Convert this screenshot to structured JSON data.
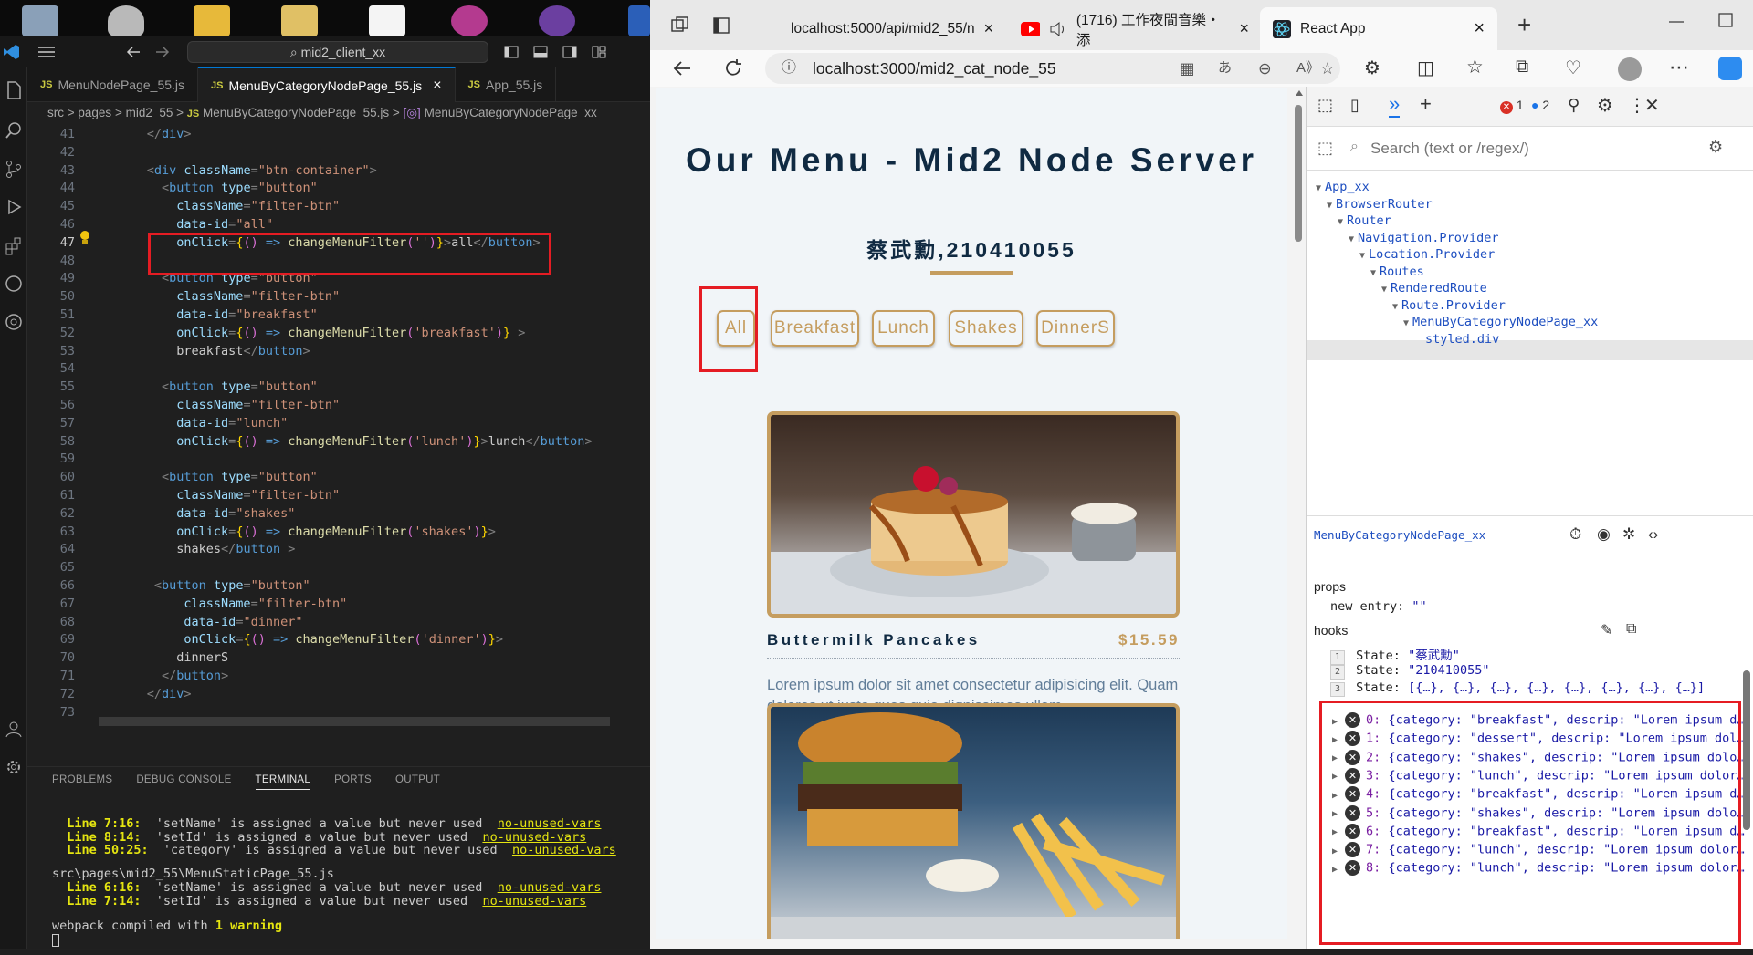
{
  "vscode": {
    "search": "mid2_client_xx",
    "tabs": [
      {
        "label": "MenuNodePage_55.js",
        "active": false
      },
      {
        "label": "MenuByCategoryNodePage_55.js",
        "active": true
      },
      {
        "label": "App_55.js",
        "active": false
      }
    ],
    "tab_close": "×",
    "breadcrumb": [
      "src",
      "pages",
      "mid2_55",
      "MenuByCategoryNodePage_55.js",
      "MenuByCategoryNodePage_xx"
    ],
    "code_lines": [
      {
        "n": "41",
        "parts": [
          [
            "g",
            "      </"
          ],
          [
            "t",
            "div"
          ],
          [
            "g",
            ">"
          ]
        ]
      },
      {
        "n": "42",
        "parts": []
      },
      {
        "n": "43",
        "parts": [
          [
            "g",
            "      <"
          ],
          [
            "t",
            "div"
          ],
          [
            "a",
            " className"
          ],
          [
            "g",
            "="
          ],
          [
            "s",
            "\"btn-container\""
          ],
          [
            "g",
            ">"
          ]
        ]
      },
      {
        "n": "44",
        "parts": [
          [
            "g",
            "        <"
          ],
          [
            "t",
            "button"
          ],
          [
            "a",
            " type"
          ],
          [
            "g",
            "="
          ],
          [
            "s",
            "\"button\""
          ]
        ]
      },
      {
        "n": "45",
        "parts": [
          [
            "a",
            "          className"
          ],
          [
            "g",
            "="
          ],
          [
            "s",
            "\"filter-btn\""
          ]
        ]
      },
      {
        "n": "46",
        "parts": [
          [
            "a",
            "          data-id"
          ],
          [
            "g",
            "="
          ],
          [
            "s",
            "\"all\""
          ]
        ]
      },
      {
        "n": "47",
        "parts": [
          [
            "a",
            "          onClick"
          ],
          [
            "g",
            "="
          ],
          [
            "b",
            "{"
          ],
          [
            "p",
            "()"
          ],
          [
            "t",
            " =>"
          ],
          [
            "f",
            " changeMenuFilter"
          ],
          [
            "p",
            "("
          ],
          [
            "s",
            "''"
          ],
          [
            "p",
            ")"
          ],
          [
            "b",
            "}"
          ],
          [
            "g",
            ">"
          ],
          [
            "x",
            "all"
          ],
          [
            "g",
            "</"
          ],
          [
            "t",
            "button"
          ],
          [
            "g",
            ">"
          ]
        ]
      },
      {
        "n": "48",
        "parts": []
      },
      {
        "n": "49",
        "parts": [
          [
            "g",
            "        <"
          ],
          [
            "t",
            "button"
          ],
          [
            "a",
            " type"
          ],
          [
            "g",
            "="
          ],
          [
            "s",
            "\"button\""
          ]
        ]
      },
      {
        "n": "50",
        "parts": [
          [
            "a",
            "          className"
          ],
          [
            "g",
            "="
          ],
          [
            "s",
            "\"filter-btn\""
          ]
        ]
      },
      {
        "n": "51",
        "parts": [
          [
            "a",
            "          data-id"
          ],
          [
            "g",
            "="
          ],
          [
            "s",
            "\"breakfast\""
          ]
        ]
      },
      {
        "n": "52",
        "parts": [
          [
            "a",
            "          onClick"
          ],
          [
            "g",
            "="
          ],
          [
            "b",
            "{"
          ],
          [
            "p",
            "()"
          ],
          [
            "t",
            " =>"
          ],
          [
            "f",
            " changeMenuFilter"
          ],
          [
            "p",
            "("
          ],
          [
            "s",
            "'breakfast'"
          ],
          [
            "p",
            ")"
          ],
          [
            "b",
            "}"
          ],
          [
            "g",
            " >"
          ]
        ]
      },
      {
        "n": "53",
        "parts": [
          [
            "x",
            "          breakfast"
          ],
          [
            "g",
            "</"
          ],
          [
            "t",
            "button"
          ],
          [
            "g",
            ">"
          ]
        ]
      },
      {
        "n": "54",
        "parts": []
      },
      {
        "n": "55",
        "parts": [
          [
            "g",
            "        <"
          ],
          [
            "t",
            "button"
          ],
          [
            "a",
            " type"
          ],
          [
            "g",
            "="
          ],
          [
            "s",
            "\"button\""
          ]
        ]
      },
      {
        "n": "56",
        "parts": [
          [
            "a",
            "          className"
          ],
          [
            "g",
            "="
          ],
          [
            "s",
            "\"filter-btn\""
          ]
        ]
      },
      {
        "n": "57",
        "parts": [
          [
            "a",
            "          data-id"
          ],
          [
            "g",
            "="
          ],
          [
            "s",
            "\"lunch\""
          ]
        ]
      },
      {
        "n": "58",
        "parts": [
          [
            "a",
            "          onClick"
          ],
          [
            "g",
            "="
          ],
          [
            "b",
            "{"
          ],
          [
            "p",
            "()"
          ],
          [
            "t",
            " =>"
          ],
          [
            "f",
            " changeMenuFilter"
          ],
          [
            "p",
            "("
          ],
          [
            "s",
            "'lunch'"
          ],
          [
            "p",
            ")"
          ],
          [
            "b",
            "}"
          ],
          [
            "g",
            ">"
          ],
          [
            "x",
            "lunch"
          ],
          [
            "g",
            "</"
          ],
          [
            "t",
            "button"
          ],
          [
            "g",
            ">"
          ]
        ]
      },
      {
        "n": "59",
        "parts": []
      },
      {
        "n": "60",
        "parts": [
          [
            "g",
            "        <"
          ],
          [
            "t",
            "button"
          ],
          [
            "a",
            " type"
          ],
          [
            "g",
            "="
          ],
          [
            "s",
            "\"button\""
          ]
        ]
      },
      {
        "n": "61",
        "parts": [
          [
            "a",
            "          className"
          ],
          [
            "g",
            "="
          ],
          [
            "s",
            "\"filter-btn\""
          ]
        ]
      },
      {
        "n": "62",
        "parts": [
          [
            "a",
            "          data-id"
          ],
          [
            "g",
            "="
          ],
          [
            "s",
            "\"shakes\""
          ]
        ]
      },
      {
        "n": "63",
        "parts": [
          [
            "a",
            "          onClick"
          ],
          [
            "g",
            "="
          ],
          [
            "b",
            "{"
          ],
          [
            "p",
            "()"
          ],
          [
            "t",
            " =>"
          ],
          [
            "f",
            " changeMenuFilter"
          ],
          [
            "p",
            "("
          ],
          [
            "s",
            "'shakes'"
          ],
          [
            "p",
            ")"
          ],
          [
            "b",
            "}"
          ],
          [
            "g",
            ">"
          ]
        ]
      },
      {
        "n": "64",
        "parts": [
          [
            "x",
            "          shakes"
          ],
          [
            "g",
            "</"
          ],
          [
            "t",
            "button"
          ],
          [
            "g",
            " >"
          ]
        ]
      },
      {
        "n": "65",
        "parts": []
      },
      {
        "n": "66",
        "parts": [
          [
            "g",
            "       <"
          ],
          [
            "t",
            "button"
          ],
          [
            "a",
            " type"
          ],
          [
            "g",
            "="
          ],
          [
            "s",
            "\"button\""
          ]
        ]
      },
      {
        "n": "67",
        "parts": [
          [
            "a",
            "           className"
          ],
          [
            "g",
            "="
          ],
          [
            "s",
            "\"filter-btn\""
          ]
        ]
      },
      {
        "n": "68",
        "parts": [
          [
            "a",
            "           data-id"
          ],
          [
            "g",
            "="
          ],
          [
            "s",
            "\"dinner\""
          ]
        ]
      },
      {
        "n": "69",
        "parts": [
          [
            "a",
            "           onClick"
          ],
          [
            "g",
            "="
          ],
          [
            "b",
            "{"
          ],
          [
            "p",
            "()"
          ],
          [
            "t",
            " =>"
          ],
          [
            "f",
            " changeMenuFilter"
          ],
          [
            "p",
            "("
          ],
          [
            "s",
            "'dinner'"
          ],
          [
            "p",
            ")"
          ],
          [
            "b",
            "}"
          ],
          [
            "g",
            ">"
          ]
        ]
      },
      {
        "n": "70",
        "parts": [
          [
            "x",
            "          dinnerS"
          ]
        ]
      },
      {
        "n": "71",
        "parts": [
          [
            "g",
            "        </"
          ],
          [
            "t",
            "button"
          ],
          [
            "g",
            ">"
          ]
        ]
      },
      {
        "n": "72",
        "parts": [
          [
            "g",
            "      </"
          ],
          [
            "t",
            "div"
          ],
          [
            "g",
            ">"
          ]
        ]
      },
      {
        "n": "73",
        "parts": []
      }
    ],
    "panel_tabs": [
      "PROBLEMS",
      "DEBUG CONSOLE",
      "TERMINAL",
      "PORTS",
      "OUTPUT"
    ],
    "terminal": {
      "warnings1": [
        {
          "pos": "  Line 7:16:",
          "msg": "  'setName' is assigned a value but never used",
          "rule": "no-unused-vars"
        },
        {
          "pos": "  Line 8:14:",
          "msg": "  'setId' is assigned a value but never used",
          "rule": "no-unused-vars"
        },
        {
          "pos": "  Line 50:25:",
          "msg": "  'category' is assigned a value but never used",
          "rule": "no-unused-vars"
        }
      ],
      "file2": "src\\pages\\mid2_55\\MenuStaticPage_55.js",
      "warnings2": [
        {
          "pos": "  Line 6:16:",
          "msg": "  'setName' is assigned a value but never used",
          "rule": "no-unused-vars"
        },
        {
          "pos": "  Line 7:14:",
          "msg": "  'setId' is assigned a value but never used",
          "rule": "no-unused-vars"
        }
      ],
      "compiled_prefix": "webpack compiled with ",
      "compiled_count": "1 warning"
    }
  },
  "browser": {
    "tabs": [
      {
        "label": "localhost:5000/api/mid2_55/n",
        "icon": "document-icon"
      },
      {
        "label": "(1716) 工作夜間音樂・添",
        "icon": "youtube-icon"
      },
      {
        "label": "React App",
        "icon": "react-icon"
      }
    ],
    "tab_close": "×",
    "url": "localhost:3000/mid2_cat_node_55",
    "accent": "#c59d5f",
    "page": {
      "title": "Our Menu - Mid2 Node Server",
      "subtitle": "蔡武勳,210410055",
      "filters": [
        "All",
        "Breakfast",
        "Lunch",
        "Shakes",
        "DinnerS"
      ],
      "item": {
        "name": "Buttermilk Pancakes",
        "price": "$15.59",
        "desc": "Lorem ipsum dolor sit amet consectetur adipisicing elit. Quam dolores ut iusto quas quia dignissimos ullam."
      }
    }
  },
  "devtools": {
    "badge_errors": "1",
    "badge_messages": "2",
    "search_placeholder": "Search (text or /regex/)",
    "tree": [
      "App_xx",
      "BrowserRouter",
      "Router",
      "Navigation.Provider",
      "Location.Provider",
      "Routes",
      "RenderedRoute",
      "Route.Provider",
      "MenuByCategoryNodePage_xx",
      "styled.div"
    ],
    "selected_component": "MenuByCategoryNodePage_xx",
    "props_label": "props",
    "props": {
      "key": "new entry:",
      "value": "\"\""
    },
    "hooks_label": "hooks",
    "hooks": [
      {
        "idx": "1",
        "key": "State:",
        "value": "\"蔡武勳\""
      },
      {
        "idx": "2",
        "key": "State:",
        "value": "\"210410055\""
      },
      {
        "idx": "3",
        "key": "State:",
        "value": "[{…}, {…}, {…}, {…}, {…}, {…}, {…}, {…}]"
      }
    ],
    "state_items": [
      {
        "i": "0:",
        "text": "{category: \"breakfast\", descrip: \"Lorem ipsum d…"
      },
      {
        "i": "1:",
        "text": "{category: \"dessert\", descrip: \"Lorem ipsum dol…"
      },
      {
        "i": "2:",
        "text": "{category: \"shakes\", descrip: \"Lorem ipsum dolo…"
      },
      {
        "i": "3:",
        "text": "{category: \"lunch\", descrip: \"Lorem ipsum dolor…"
      },
      {
        "i": "4:",
        "text": "{category: \"breakfast\", descrip: \"Lorem ipsum d…"
      },
      {
        "i": "5:",
        "text": "{category: \"shakes\", descrip: \"Lorem ipsum dolo…"
      },
      {
        "i": "6:",
        "text": "{category: \"breakfast\", descrip: \"Lorem ipsum d…"
      },
      {
        "i": "7:",
        "text": "{category: \"lunch\", descrip: \"Lorem ipsum dolor…"
      },
      {
        "i": "8:",
        "text": "{category: \"lunch\", descrip: \"Lorem ipsum dolor…"
      }
    ]
  }
}
